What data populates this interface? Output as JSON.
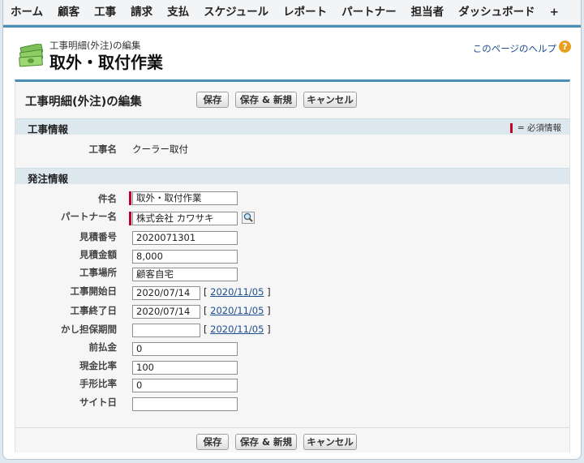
{
  "nav": {
    "items": [
      "ホーム",
      "顧客",
      "工事",
      "請求",
      "支払",
      "スケジュール",
      "レポート",
      "パートナー",
      "担当者",
      "ダッシュボード",
      "+"
    ]
  },
  "header": {
    "subtitle": "工事明細(外注)の編集",
    "title": "取外・取付作業",
    "help_link": "このページのヘルプ",
    "help_icon_glyph": "?"
  },
  "panel": {
    "title": "工事明細(外注)の編集",
    "buttons": {
      "save": "保存",
      "save_new": "保存 & 新規",
      "cancel": "キャンセル"
    }
  },
  "sections": {
    "work_info": {
      "title": "工事情報",
      "required_legend": "= 必須情報",
      "fields": {
        "work_name_label": "工事名",
        "work_name_value": "クーラー取付"
      }
    },
    "order_info": {
      "title": "発注情報",
      "fields": {
        "subject": {
          "label": "件名",
          "value": "取外・取付作業",
          "required": true
        },
        "partner": {
          "label": "パートナー名",
          "value": "株式会社 カワサキ",
          "required": true
        },
        "estimate_no": {
          "label": "見積番号",
          "value": "2020071301"
        },
        "estimate_amount": {
          "label": "見積金額",
          "value": "8,000"
        },
        "work_place": {
          "label": "工事場所",
          "value": "顧客自宅"
        },
        "start_date": {
          "label": "工事開始日",
          "value": "2020/07/14",
          "today": "2020/11/05"
        },
        "end_date": {
          "label": "工事終了日",
          "value": "2020/07/14",
          "today": "2020/11/05"
        },
        "warranty": {
          "label": "かし担保期間",
          "value": "",
          "today": "2020/11/05"
        },
        "advance": {
          "label": "前払金",
          "value": "0"
        },
        "cash_ratio": {
          "label": "現金比率",
          "value": "100"
        },
        "bill_ratio": {
          "label": "手形比率",
          "value": "0"
        },
        "site_days": {
          "label": "サイト日",
          "value": ""
        }
      }
    }
  },
  "colors": {
    "accent": "#4b8fb8",
    "required": "#c0002a",
    "link": "#1d4e8f",
    "section_bg": "#dce7ee"
  },
  "icons": {
    "header": "money-stack-icon",
    "lookup": "magnifier-lookup-icon",
    "help": "help-question-icon"
  }
}
